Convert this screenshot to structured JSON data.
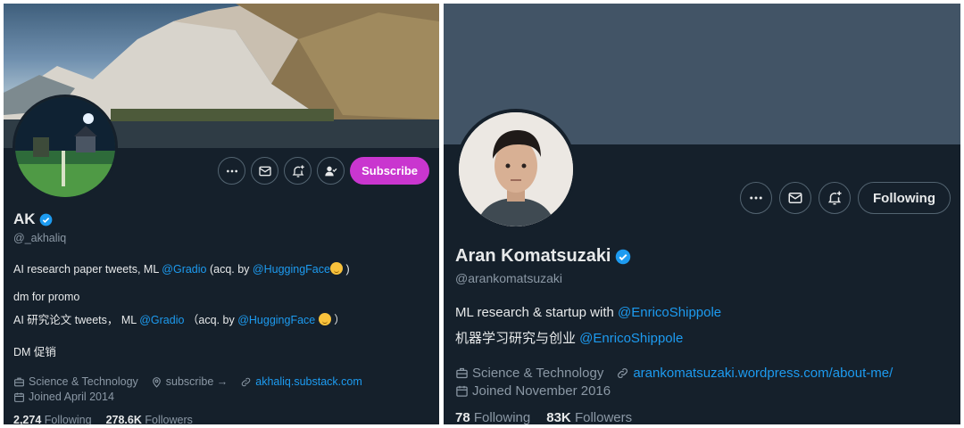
{
  "left": {
    "profile": {
      "name": "AK",
      "handle": "@_akhaliq"
    },
    "actions": {
      "more_icon": "more-icon",
      "message_icon": "mail-icon",
      "notify_icon": "bell-plus-icon",
      "follow_icon": "person-check-icon",
      "subscribe_label": "Subscribe"
    },
    "bio": {
      "line1_a": "AI research paper tweets, ML ",
      "line1_mention1": "@Gradio",
      "line1_b": " (acq. by ",
      "line1_mention2": "@HuggingFace",
      "line1_c": " )",
      "line2": "dm for promo",
      "line3_a": "AI 研究论文 tweets， ML ",
      "line3_mention1": "@Gradio",
      "line3_b": " （acq. by ",
      "line3_mention2": "@HuggingFace",
      "line3_c": " ）",
      "line4": "DM 促销"
    },
    "meta": {
      "category": "Science & Technology",
      "location": "subscribe →",
      "website": "akhaliq.substack.com",
      "joined": "Joined April 2014"
    },
    "stats": {
      "following_count": "2,274",
      "following_label": "Following",
      "followers_count": "278.6K",
      "followers_label": "Followers"
    }
  },
  "right": {
    "profile": {
      "name": "Aran Komatsuzaki",
      "handle": "@arankomatsuzaki"
    },
    "actions": {
      "more_icon": "more-icon",
      "message_icon": "mail-icon",
      "notify_icon": "bell-plus-icon",
      "following_label": "Following"
    },
    "bio": {
      "line1_a": "ML research & startup with ",
      "line1_mention": "@EnricoShippole",
      "line2_a": "机器学习研究与创业 ",
      "line2_mention": "@EnricoShippole"
    },
    "meta": {
      "category": "Science & Technology",
      "website": "arankomatsuzaki.wordpress.com/about-me/",
      "joined": "Joined November 2016"
    },
    "stats": {
      "following_count": "78",
      "following_label": "Following",
      "followers_count": "83K",
      "followers_label": "Followers"
    }
  },
  "colors": {
    "background": "#15202b",
    "accent_blue": "#1d9bf0",
    "subscribe_pink": "#c936cf",
    "muted_text": "#8b98a5",
    "right_banner": "#425466"
  }
}
